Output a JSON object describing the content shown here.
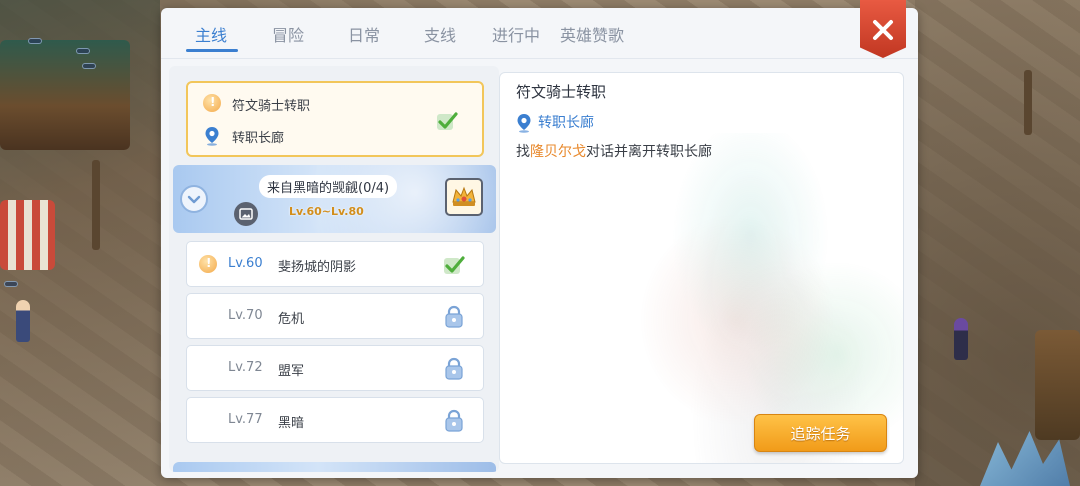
{
  "tabs": [
    {
      "label": "主线",
      "active": true
    },
    {
      "label": "冒险",
      "active": false
    },
    {
      "label": "日常",
      "active": false
    },
    {
      "label": "支线",
      "active": false
    },
    {
      "label": "进行中",
      "active": false
    },
    {
      "label": "英雄赞歌",
      "active": false
    }
  ],
  "current_quest": {
    "title": "符文骑士转职",
    "location": "转职长廊",
    "status": "completed"
  },
  "chapter": {
    "title": "来自黑暗的觊觎(0/4)",
    "level_range": "Lv.60~Lv.80",
    "expanded": true
  },
  "quest_list": [
    {
      "level": "Lv.60",
      "name": "斐扬城的阴影",
      "status": "completed"
    },
    {
      "level": "Lv.70",
      "name": "危机",
      "status": "locked"
    },
    {
      "level": "Lv.72",
      "name": "盟军",
      "status": "locked"
    },
    {
      "level": "Lv.77",
      "name": "黑暗",
      "status": "locked"
    }
  ],
  "detail": {
    "title": "符文骑士转职",
    "location": "转职长廊",
    "desc_prefix": "找",
    "desc_npc": "隆贝尔戈",
    "desc_suffix": "对话并离开转职长廊",
    "track_button": "追踪任务"
  },
  "colors": {
    "accent_blue": "#3b7fd0",
    "highlight_gold": "#f2c65a",
    "npc_orange": "#e8882b",
    "close_red": "#c13722",
    "button_orange": "#f19b19"
  }
}
